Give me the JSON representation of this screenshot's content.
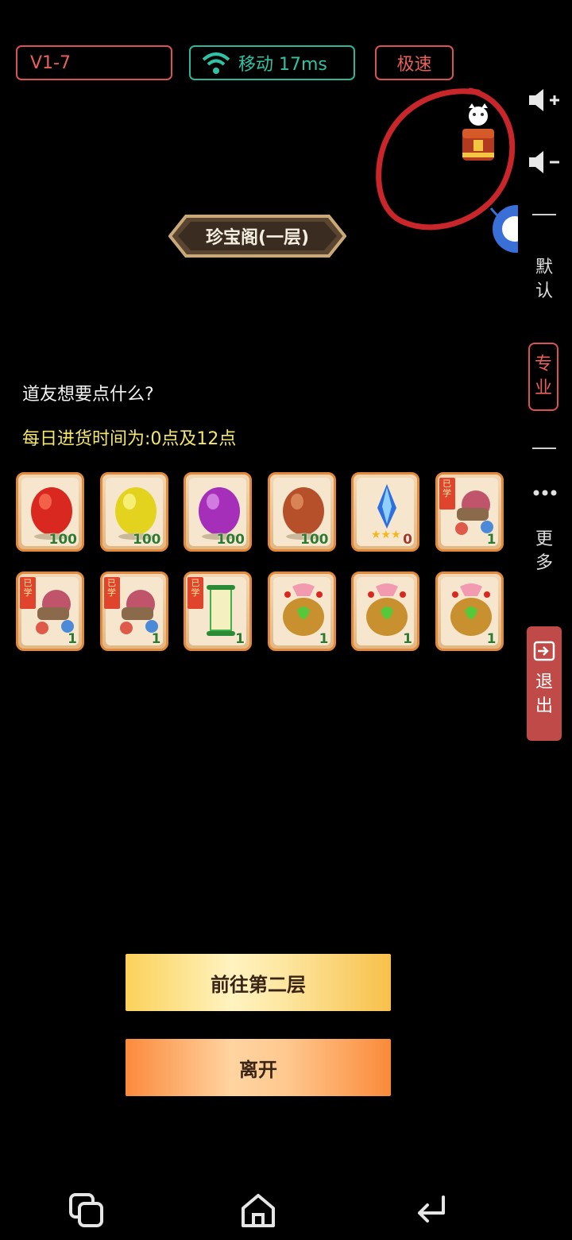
{
  "status": {
    "version": "V1-7",
    "network": "移动 17ms",
    "speed_mode": "极速"
  },
  "sidebar": {
    "default_label": "默认",
    "pro_label": "专业",
    "more_label": "更多",
    "exit_label": "退出"
  },
  "shop": {
    "title": "珍宝阁(一层)",
    "question": "道友想要点什么?",
    "schedule": "每日进货时间为:0点及12点"
  },
  "items": [
    {
      "name": "red-egg-item",
      "icon": "egg-red",
      "qty": "100"
    },
    {
      "name": "yellow-egg-item",
      "icon": "egg-yellow",
      "qty": "100"
    },
    {
      "name": "purple-egg-item",
      "icon": "egg-purple",
      "qty": "100"
    },
    {
      "name": "brown-egg-item",
      "icon": "egg-brown",
      "qty": "100"
    },
    {
      "name": "blue-crystal-item",
      "icon": "blue-crystal-3star",
      "qty": "0"
    },
    {
      "name": "cannon-scroll-item",
      "icon": "cannon",
      "qty": "1",
      "tag": "已学"
    },
    {
      "name": "cannon-scroll-item-2",
      "icon": "cannon",
      "qty": "1",
      "tag": "已学"
    },
    {
      "name": "cannon-scroll-item-3",
      "icon": "cannon",
      "qty": "1",
      "tag": "已学"
    },
    {
      "name": "green-scroll-item",
      "icon": "green-scroll",
      "qty": "1",
      "tag": "已学"
    },
    {
      "name": "treasure-bag-item",
      "icon": "money-bag",
      "qty": "1"
    },
    {
      "name": "treasure-bag-item-2",
      "icon": "money-bag",
      "qty": "1"
    },
    {
      "name": "treasure-bag-item-3",
      "icon": "money-bag",
      "qty": "1"
    }
  ],
  "actions": {
    "next_floor": "前往第二层",
    "leave": "离开"
  },
  "colors": {
    "accent_red": "#d9534f",
    "accent_teal": "#2bb89a",
    "schedule_yellow": "#f5e76a"
  }
}
